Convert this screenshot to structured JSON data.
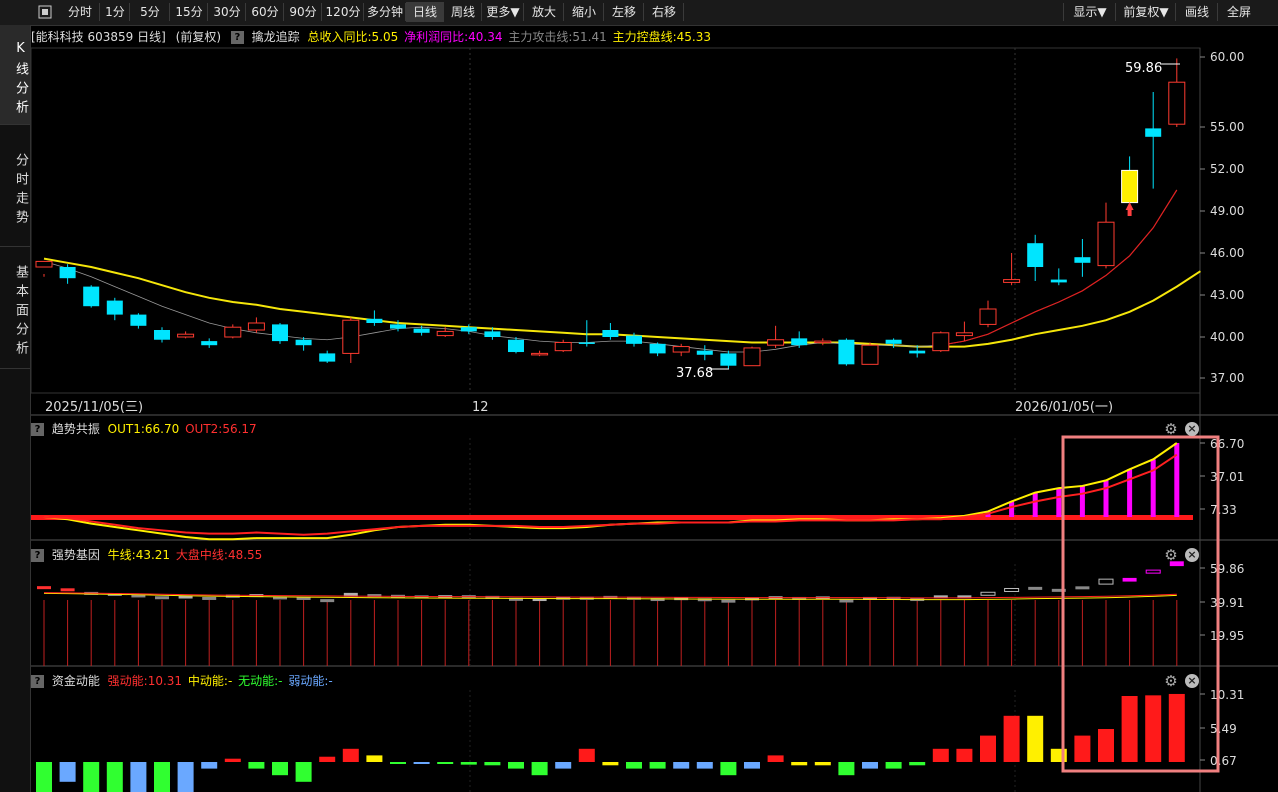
{
  "toolbar": {
    "buttons": [
      "分时",
      "1分",
      "5分",
      "15分",
      "30分",
      "60分",
      "90分",
      "120分",
      "多分钟",
      "日线",
      "周线",
      "更多▼",
      "放大",
      "缩小",
      "左移",
      "右移"
    ],
    "right_buttons": [
      "显示▼",
      "前复权▼",
      "画线",
      "全屏"
    ]
  },
  "left_nav": [
    "K线分析",
    "分时走势",
    "基本面分析"
  ],
  "header": {
    "stock": "[能科科技 603859 日线]",
    "adjust": "(前复权)",
    "indicator": "擒龙追踪",
    "rev": "总收入同比:5.05",
    "profit": "净利润同比:40.34",
    "attack": "主力攻击线:51.41",
    "control": "主力控盘线:45.33"
  },
  "main_chart": {
    "high_label": "59.86",
    "low_label": "37.68",
    "y_ticks": [
      "60.00",
      "55.00",
      "52.00",
      "49.00",
      "46.00",
      "43.00",
      "40.00",
      "37.00"
    ],
    "y_values": [
      60,
      55,
      52,
      49,
      46,
      43,
      40,
      37
    ],
    "dates": [
      "2025/11/05(三)",
      "12",
      "2026/01/05(一)"
    ]
  },
  "panel1": {
    "name": "趋势共振",
    "out1": "OUT1:66.70",
    "out2": "OUT2:56.17",
    "y_ticks": [
      "66.70",
      "37.01",
      "7.33"
    ]
  },
  "panel2": {
    "name": "强势基因",
    "bull": "牛线:43.21",
    "market": "大盘中线:48.55",
    "y_ticks": [
      "59.86",
      "39.91",
      "19.95"
    ]
  },
  "panel3": {
    "name": "资金动能",
    "strong": "强动能:10.31",
    "mid": "中动能:-",
    "none": "无动能:-",
    "weak": "弱动能:-",
    "y_ticks": [
      "10.31",
      "5.49",
      "0.67"
    ]
  },
  "colors": {
    "up": "#ff3b30",
    "down": "#00e5ff",
    "ma_yellow": "#f5e60a",
    "ma_red": "#e02020",
    "magenta": "#ff00ff",
    "highlight": "#f08080"
  },
  "candles": [
    [
      45.0,
      45.4,
      44.5,
      44.3
    ],
    [
      45.0,
      44.2,
      45.2,
      43.8
    ],
    [
      43.6,
      42.2,
      43.7,
      42.1
    ],
    [
      42.6,
      41.6,
      42.8,
      41.2
    ],
    [
      41.6,
      40.8,
      41.7,
      40.6
    ],
    [
      40.5,
      39.8,
      40.7,
      39.6
    ],
    [
      40.0,
      40.2,
      40.4,
      39.9
    ],
    [
      39.7,
      39.4,
      39.9,
      39.2
    ],
    [
      40.0,
      40.7,
      40.9,
      39.9
    ],
    [
      40.5,
      41.0,
      41.4,
      40.3
    ],
    [
      40.9,
      39.7,
      41.0,
      39.5
    ],
    [
      39.8,
      39.4,
      40.0,
      39.0
    ],
    [
      38.8,
      38.2,
      39.0,
      38.1
    ],
    [
      38.8,
      41.2,
      41.4,
      38.1
    ],
    [
      41.3,
      41.0,
      41.9,
      40.8
    ],
    [
      40.9,
      40.6,
      41.2,
      40.4
    ],
    [
      40.6,
      40.3,
      40.8,
      40.1
    ],
    [
      40.1,
      40.4,
      40.7,
      40.0
    ],
    [
      40.7,
      40.4,
      40.9,
      40.2
    ],
    [
      40.4,
      40.0,
      40.7,
      39.8
    ],
    [
      39.8,
      38.9,
      40.0,
      38.8
    ],
    [
      38.8,
      38.8,
      39.0,
      38.6
    ],
    [
      39.0,
      39.6,
      39.8,
      38.9
    ],
    [
      39.6,
      39.5,
      41.2,
      39.3
    ],
    [
      40.5,
      40.0,
      41.0,
      39.8
    ],
    [
      40.1,
      39.5,
      40.3,
      39.3
    ],
    [
      39.5,
      38.8,
      39.6,
      38.6
    ],
    [
      38.9,
      39.3,
      39.5,
      38.6
    ],
    [
      39.0,
      38.7,
      39.4,
      38.3
    ],
    [
      38.8,
      37.9,
      39.0,
      37.7
    ],
    [
      37.9,
      39.2,
      39.3,
      37.9
    ],
    [
      39.4,
      39.8,
      40.8,
      39.2
    ],
    [
      39.9,
      39.4,
      40.4,
      39.2
    ],
    [
      39.7,
      39.7,
      39.9,
      39.4
    ],
    [
      39.8,
      38.0,
      39.9,
      37.9
    ],
    [
      38.0,
      39.4,
      39.6,
      38.0
    ],
    [
      39.8,
      39.5,
      39.9,
      39.2
    ],
    [
      39.0,
      38.8,
      39.4,
      38.5
    ],
    [
      39.0,
      40.3,
      40.4,
      38.9
    ],
    [
      40.1,
      40.3,
      41.1,
      39.7
    ],
    [
      40.9,
      42.0,
      42.6,
      40.7
    ],
    [
      43.9,
      44.1,
      46.0,
      43.7
    ],
    [
      46.7,
      45.0,
      47.3,
      44.0
    ],
    [
      44.1,
      43.9,
      44.9,
      43.7
    ],
    [
      45.7,
      45.3,
      47.0,
      44.3
    ],
    [
      45.1,
      48.2,
      49.6,
      44.9
    ],
    [
      51.9,
      49.6,
      52.9,
      49.4
    ],
    [
      54.9,
      54.3,
      57.5,
      50.6
    ],
    [
      55.2,
      58.2,
      59.9,
      55.0
    ]
  ],
  "ma_yellow": [
    45.6,
    45.3,
    45.0,
    44.6,
    44.2,
    43.7,
    43.2,
    42.8,
    42.5,
    42.3,
    42.0,
    41.8,
    41.6,
    41.4,
    41.2,
    41.0,
    40.9,
    40.8,
    40.7,
    40.6,
    40.5,
    40.4,
    40.3,
    40.2,
    40.2,
    40.1,
    40.0,
    39.9,
    39.8,
    39.7,
    39.6,
    39.6,
    39.6,
    39.6,
    39.6,
    39.5,
    39.4,
    39.3,
    39.3,
    39.3,
    39.5,
    39.8,
    40.2,
    40.5,
    40.8,
    41.2,
    41.8,
    42.6,
    43.6,
    44.7
  ],
  "ma_red": [
    45.4,
    44.9,
    44.3,
    43.6,
    42.9,
    42.2,
    41.6,
    41.0,
    40.6,
    40.3,
    40.1,
    39.9,
    39.8,
    40.0,
    40.3,
    40.6,
    40.7,
    40.6,
    40.4,
    40.1,
    39.9,
    39.7,
    39.6,
    39.6,
    39.7,
    39.7,
    39.5,
    39.3,
    39.1,
    38.9,
    38.9,
    39.1,
    39.4,
    39.6,
    39.5,
    39.4,
    39.4,
    39.3,
    39.4,
    39.7,
    40.2,
    41.0,
    41.8,
    42.5,
    43.3,
    44.4,
    45.8,
    47.8,
    50.5
  ],
  "panel1_out1": [
    0,
    -2,
    -6,
    -9,
    -12,
    -15,
    -18,
    -20,
    -20,
    -19,
    -19,
    -19,
    -19,
    -16,
    -12,
    -9,
    -8,
    -7,
    -7,
    -8,
    -9,
    -10,
    -10,
    -9,
    -7,
    -6,
    -5,
    -5,
    -5,
    -5,
    -3,
    -3,
    -2,
    -2,
    -3,
    -3,
    -2,
    -2,
    -1,
    1,
    5,
    14,
    22,
    26,
    28,
    33,
    43,
    52,
    66.7
  ],
  "panel1_out2": [
    0,
    -1,
    -4,
    -7,
    -10,
    -12,
    -14,
    -15,
    -15,
    -14,
    -15,
    -16,
    -15,
    -13,
    -11,
    -9,
    -8,
    -8,
    -8,
    -8,
    -8,
    -9,
    -9,
    -8,
    -7,
    -6,
    -6,
    -5,
    -5,
    -5,
    -4,
    -4,
    -3,
    -3,
    -3,
    -3,
    -3,
    -2,
    -2,
    0,
    3,
    9,
    14,
    18,
    21,
    26,
    34,
    42,
    56.2
  ],
  "panel3_values": [
    -5,
    -3,
    -6,
    -8,
    -7,
    -5,
    -5,
    -1,
    0.5,
    -1,
    -2,
    -3,
    0.8,
    2,
    1,
    0,
    -0.2,
    -0.3,
    -0.4,
    -0.5,
    -1,
    -2,
    -1,
    2,
    -0.5,
    -1,
    -1,
    -1,
    -1,
    -2,
    -1,
    1,
    -0.5,
    -0.5,
    -2,
    -1,
    -1,
    -0.5,
    2,
    2,
    4,
    7,
    7,
    2,
    4,
    5,
    10.0,
    10.1,
    10.31
  ],
  "panel3_types": [
    "g",
    "b",
    "g",
    "g",
    "b",
    "g",
    "b",
    "b",
    "r",
    "g",
    "g",
    "g",
    "r",
    "r",
    "y",
    "g",
    "b",
    "g",
    "g",
    "g",
    "g",
    "g",
    "b",
    "r",
    "y",
    "g",
    "g",
    "b",
    "b",
    "g",
    "b",
    "r",
    "y",
    "y",
    "g",
    "b",
    "g",
    "g",
    "r",
    "r",
    "r",
    "r",
    "y",
    "y",
    "r",
    "r",
    "r",
    "r",
    "r"
  ]
}
